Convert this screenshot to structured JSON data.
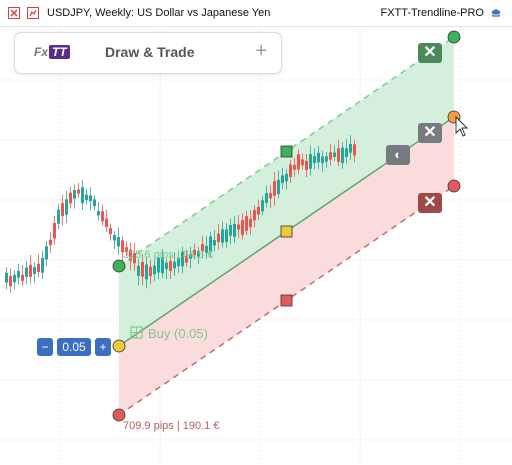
{
  "window": {
    "title": "USDJPY, Weekly:  US Dollar vs Japanese Yen",
    "indicator_name": "FXTT-Trendline-PRO"
  },
  "panel": {
    "logo_fx": "Fx",
    "logo_tt": "TT",
    "title": "Draw & Trade",
    "add_label": "+"
  },
  "trade": {
    "order_label": "Buy (0.05)",
    "lot_value": "0.05",
    "lot_minus": "−",
    "lot_plus": "+",
    "tp_label": "325.6 pips | 84.5 €",
    "sl_label": "709.9 pips | 190.1 €",
    "close_symbol": "✕",
    "toggle_symbol": "◐"
  },
  "colors": {
    "tp_zone": "#d4f0dc",
    "sl_zone": "#fbdcdc",
    "tp_line": "#7fc98f",
    "sl_line": "#c86b6b",
    "entry_line": "#5ea96a",
    "bull_candle": "#26a69a",
    "bear_candle": "#ef5350"
  }
}
